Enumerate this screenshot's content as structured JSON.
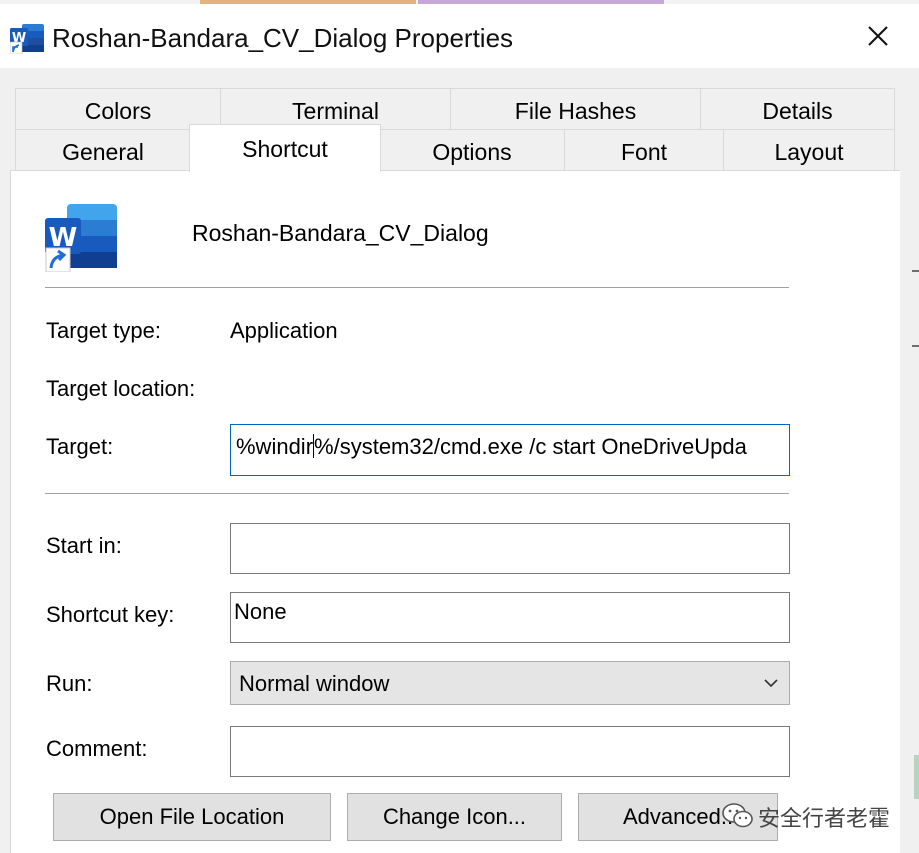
{
  "window": {
    "title": "Roshan-Bandara_CV_Dialog Properties",
    "close_icon": "close-icon",
    "app_icon": "word-shortcut-icon"
  },
  "tabs": {
    "row_top": [
      "Colors",
      "Terminal",
      "File Hashes",
      "Details"
    ],
    "row_bottom": [
      "General",
      "Shortcut",
      "Options",
      "Font",
      "Layout"
    ],
    "selected": "Shortcut"
  },
  "shortcut": {
    "name": "Roshan-Bandara_CV_Dialog",
    "icon": "word-document-icon",
    "target_type_label": "Target type:",
    "target_type_value": "Application",
    "target_location_label": "Target location:",
    "target_location_value": "",
    "target_label": "Target:",
    "target_value_before_caret": "%windir",
    "target_value_after_caret": "%/system32/cmd.exe /c start OneDriveUpda",
    "start_in_label": "Start in:",
    "start_in_value": "",
    "shortcut_key_label": "Shortcut key:",
    "shortcut_key_value": "None",
    "run_label": "Run:",
    "run_value": "Normal window",
    "comment_label": "Comment:",
    "comment_value": ""
  },
  "buttons": {
    "open_file_location": "Open File Location",
    "change_icon": "Change Icon...",
    "advanced": "Advanced..."
  },
  "watermark": {
    "text": "安全行者老霍",
    "icon": "wechat-icon"
  },
  "colors": {
    "word_blue": "#185abd",
    "focus_border": "#0067c0",
    "dialog_bg": "#f0f0f0"
  }
}
